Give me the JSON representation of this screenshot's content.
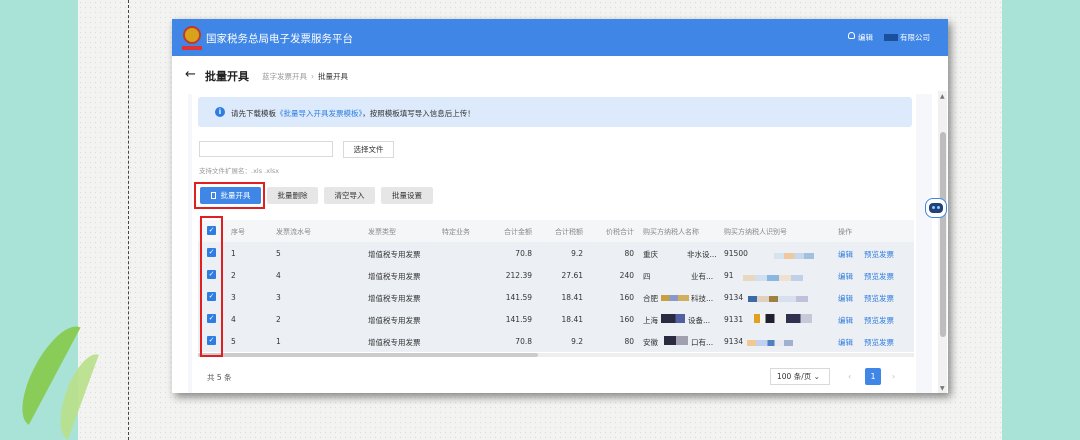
{
  "header": {
    "app_title": "国家税务总局电子发票服务平台",
    "user_name": "编辑",
    "company": "有限公司"
  },
  "page": {
    "title": "批量开具",
    "breadcrumb": [
      "蓝字发票开具",
      "批量开具"
    ]
  },
  "alert": {
    "prefix": "请先下载模板",
    "link": "《批量导入开具发票模板》",
    "suffix": "，按照模板填写导入信息后上传！"
  },
  "upload": {
    "choose_label": "选择文件",
    "hint": "支持文件扩展名：.xls .xlsx"
  },
  "toolbar": {
    "batch_issue": "批量开具",
    "batch_delete": "批量删除",
    "clear_import": "清空导入",
    "batch_settings": "批量设置"
  },
  "table": {
    "columns": [
      "序号",
      "发票流水号",
      "发票类型",
      "特定业务",
      "合计金额",
      "合计税额",
      "价税合计",
      "购买方纳税人名称",
      "购买方纳税人识别号",
      "操作"
    ],
    "rows": [
      {
        "index": "1",
        "serial": "5",
        "type": "增值税专用发票",
        "special": "",
        "amount": "70.8",
        "tax": "9.2",
        "total": "80",
        "buyer_prefix": "重庆",
        "buyer_suffix": "非水设...",
        "taxid": "91500",
        "edit": "编辑",
        "preview": "预览发票"
      },
      {
        "index": "2",
        "serial": "4",
        "type": "增值税专用发票",
        "special": "",
        "amount": "212.39",
        "tax": "27.61",
        "total": "240",
        "buyer_prefix": "四",
        "buyer_suffix": "业有...",
        "taxid": "91",
        "edit": "编辑",
        "preview": "预览发票"
      },
      {
        "index": "3",
        "serial": "3",
        "type": "增值税专用发票",
        "special": "",
        "amount": "141.59",
        "tax": "18.41",
        "total": "160",
        "buyer_prefix": "合肥",
        "buyer_suffix": "科技...",
        "taxid": "9134",
        "edit": "编辑",
        "preview": "预览发票"
      },
      {
        "index": "4",
        "serial": "2",
        "type": "增值税专用发票",
        "special": "",
        "amount": "141.59",
        "tax": "18.41",
        "total": "160",
        "buyer_prefix": "上海",
        "buyer_suffix": "设备...",
        "taxid": "9131",
        "edit": "编辑",
        "preview": "预览发票"
      },
      {
        "index": "5",
        "serial": "1",
        "type": "增值税专用发票",
        "special": "",
        "amount": "70.8",
        "tax": "9.2",
        "total": "80",
        "buyer_prefix": "安徽",
        "buyer_suffix": "口有...",
        "taxid": "9134",
        "edit": "编辑",
        "preview": "预览发票"
      }
    ]
  },
  "pagination": {
    "total": "共 5 条",
    "page_size": "100 条/页",
    "page_size_arrow": "⌄",
    "current_page": "1",
    "prev": "‹",
    "next": "›"
  },
  "icons": {
    "back": "←",
    "info": "i",
    "check": "✓",
    "crumb_separator": "›",
    "scroll_up": "▲",
    "scroll_down": "▼"
  },
  "colors": {
    "primary": "#3f86e6",
    "highlight_box": "#e02020",
    "background": "#a9e3d8"
  }
}
